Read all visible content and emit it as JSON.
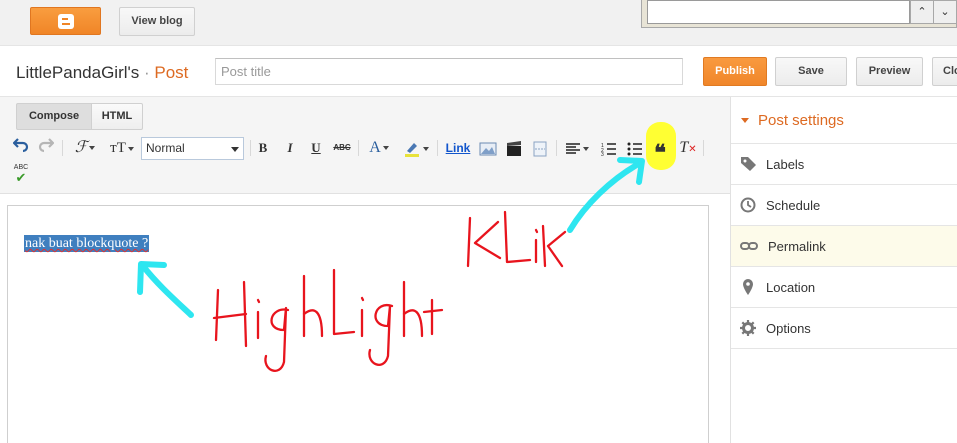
{
  "topbar": {
    "logo": "blogger-logo",
    "view_blog": "View blog"
  },
  "popup": {
    "up": "⌃",
    "down": "⌄"
  },
  "header": {
    "blog_name": "LittlePandaGirl's",
    "separator": "·",
    "section": "Post",
    "title_placeholder": "Post title",
    "publish": "Publish",
    "save": "Save",
    "preview": "Preview",
    "close": "Clo"
  },
  "modes": {
    "compose": "Compose",
    "html": "HTML"
  },
  "toolbar": {
    "format_value": "Normal",
    "link": "Link",
    "spell_abc": "ABC"
  },
  "editor": {
    "content": "nak buat blockquote ?"
  },
  "post_settings": {
    "title": "Post settings",
    "items": [
      {
        "label": "Labels",
        "icon": "tag-icon"
      },
      {
        "label": "Schedule",
        "icon": "clock-icon"
      },
      {
        "label": "Permalink",
        "icon": "link-icon"
      },
      {
        "label": "Location",
        "icon": "pin-icon"
      },
      {
        "label": "Options",
        "icon": "gear-icon"
      }
    ]
  },
  "annotations": {
    "klik": "KLiK",
    "highlight": "HighLight"
  },
  "colors": {
    "accent": "#f08527",
    "annotation_red": "#e8141d",
    "annotation_cyan": "#2ee6f0",
    "quote_highlight": "#ffff33",
    "selection": "#3f7fbf"
  }
}
